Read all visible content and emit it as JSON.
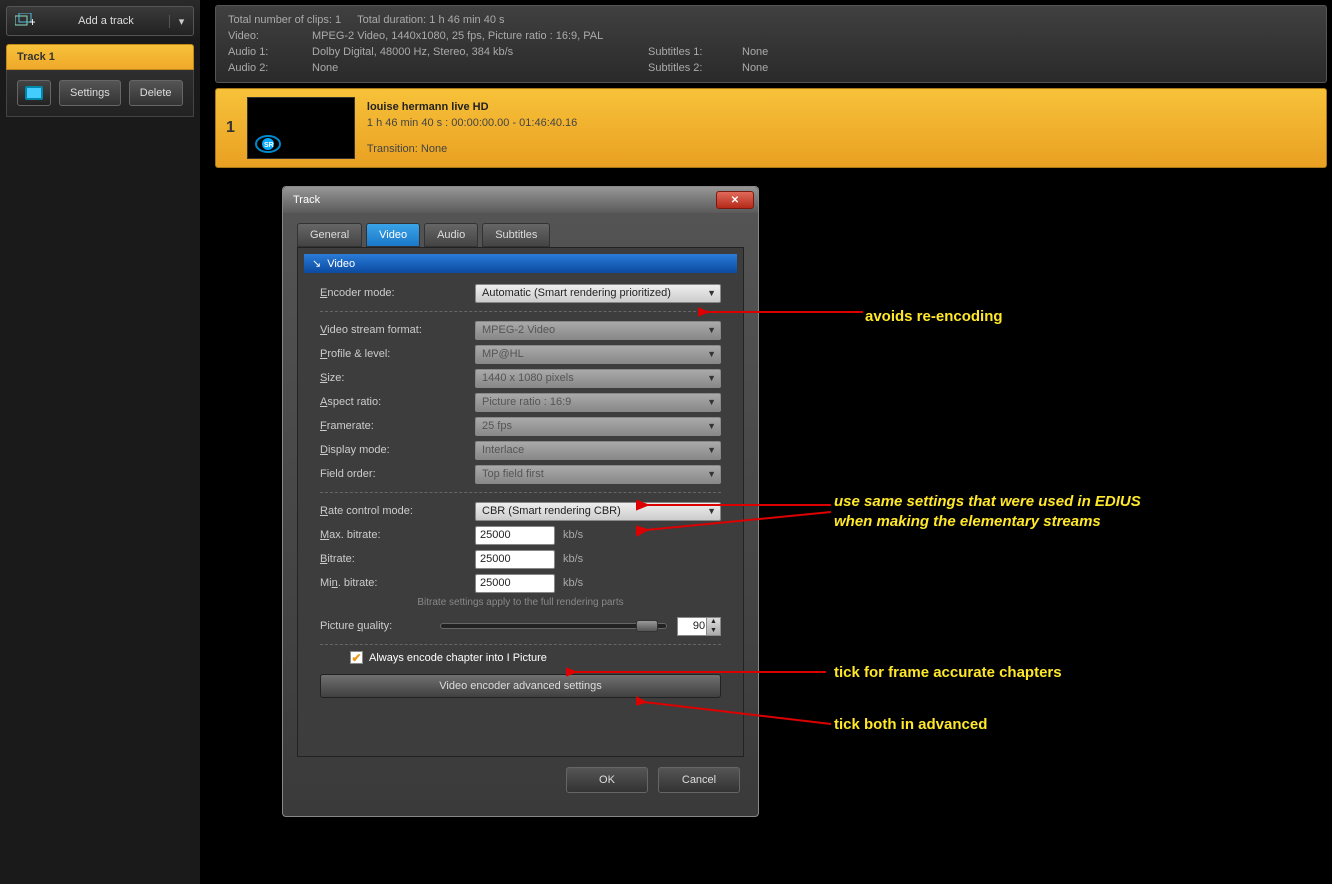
{
  "sidebar": {
    "addTrack": "Add a track",
    "trackName": "Track 1",
    "settingsBtn": "Settings",
    "deleteBtn": "Delete"
  },
  "infobar": {
    "clipsLine": "Total number of clips: 1",
    "durationLine": "Total duration: 1 h 46 min 40 s",
    "videoLabel": "Video:",
    "videoValue": "MPEG-2 Video,  1440x1080,  25 fps,  Picture ratio : 16:9,  PAL",
    "audio1Label": "Audio 1:",
    "audio1Value": "Dolby Digital,  48000 Hz,  Stereo,  384 kb/s",
    "audio2Label": "Audio 2:",
    "audio2Value": "None",
    "sub1Label": "Subtitles 1:",
    "sub1Value": "None",
    "sub2Label": "Subtitles 2:",
    "sub2Value": "None"
  },
  "clip": {
    "index": "1",
    "title": "louise hermann live HD",
    "timing": "1 h 46 min 40 s :  00:00:00.00 - 01:46:40.16",
    "transition": "Transition: None"
  },
  "dialog": {
    "title": "Track",
    "tabs": {
      "general": "General",
      "video": "Video",
      "audio": "Audio",
      "subtitles": "Subtitles"
    },
    "sectionTitle": "Video",
    "encoderMode": {
      "label": "Encoder mode:",
      "value": "Automatic (Smart rendering prioritized)"
    },
    "streamFormat": {
      "label": "Video stream format:",
      "value": "MPEG-2 Video"
    },
    "profile": {
      "label": "Profile & level:",
      "value": "MP@HL"
    },
    "size": {
      "label": "Size:",
      "value": "1440 x 1080 pixels"
    },
    "aspect": {
      "label": "Aspect ratio:",
      "value": "Picture ratio : 16:9"
    },
    "framerate": {
      "label": "Framerate:",
      "value": "25  fps"
    },
    "display": {
      "label": "Display mode:",
      "value": "Interlace"
    },
    "fieldOrder": {
      "label": "Field order:",
      "value": "Top field first"
    },
    "rateMode": {
      "label": "Rate control mode:",
      "value": "CBR (Smart rendering CBR)"
    },
    "maxBitrate": {
      "label": "Max. bitrate:",
      "value": "25000",
      "unit": "kb/s"
    },
    "bitrate": {
      "label": "Bitrate:",
      "value": "25000",
      "unit": "kb/s"
    },
    "minBitrate": {
      "label": "Min. bitrate:",
      "value": "25000",
      "unit": "kb/s"
    },
    "note": "Bitrate settings apply to the full rendering parts",
    "picQuality": {
      "label": "Picture quality:",
      "value": "90"
    },
    "chkLabel": "Always encode chapter into I Picture",
    "advBtn": "Video encoder advanced settings",
    "ok": "OK",
    "cancel": "Cancel"
  },
  "annotations": {
    "a1": "avoids re-encoding",
    "a2a": "use same settings that were used in EDIUS",
    "a2b": "when making the elementary streams",
    "a3": "tick for frame accurate chapters",
    "a4": "tick both in advanced"
  }
}
